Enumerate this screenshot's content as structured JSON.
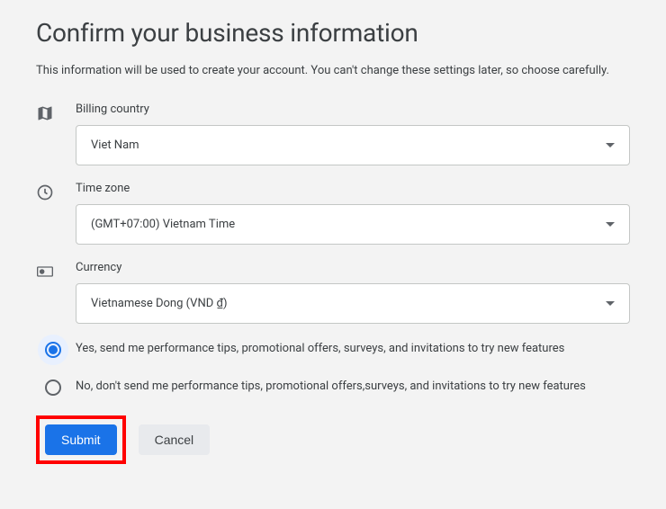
{
  "title": "Confirm your business information",
  "subtitle": "This information will be used to create your account. You can't change these settings later, so choose carefully.",
  "fields": {
    "billing_country": {
      "label": "Billing country",
      "value": "Viet Nam"
    },
    "time_zone": {
      "label": "Time zone",
      "value": "(GMT+07:00) Vietnam Time"
    },
    "currency": {
      "label": "Currency",
      "value": "Vietnamese Dong (VND ₫)"
    }
  },
  "radio": {
    "yes": "Yes, send me performance tips, promotional offers, surveys, and invitations to try new features",
    "no": "No, don't send me performance tips, promotional offers,surveys, and invitations to try new features",
    "selected": "yes"
  },
  "buttons": {
    "submit": "Submit",
    "cancel": "Cancel"
  }
}
